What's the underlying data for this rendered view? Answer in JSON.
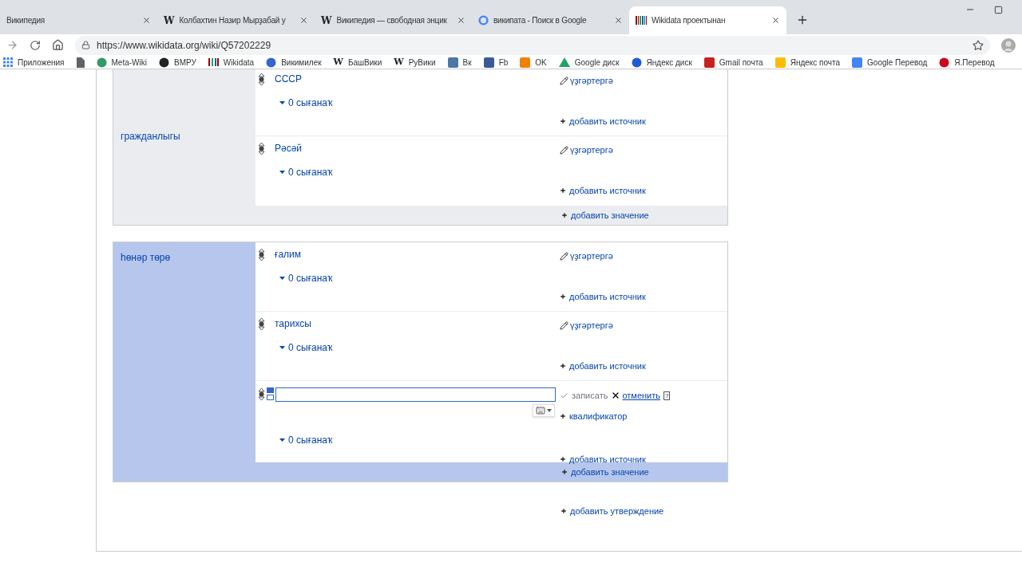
{
  "tabs": [
    {
      "title": "Википедия",
      "kind": "blank",
      "selected": false
    },
    {
      "title": "Колбахтин Назир Мырҙабай у",
      "kind": "letter",
      "badge": "W",
      "selected": false
    },
    {
      "title": "Википедия — свободная энцик",
      "kind": "letter",
      "badge": "W",
      "selected": false
    },
    {
      "title": "википата - Поиск в Google",
      "kind": "ring",
      "selected": false
    },
    {
      "title": "Wikidata проектынан",
      "kind": "bars",
      "selected": true
    }
  ],
  "address": "https://www.wikidata.org/wiki/Q57202229",
  "bookmarks": [
    {
      "label": "Приложения",
      "color": "#4285f4",
      "kind": "apps"
    },
    {
      "color": "#5f6368",
      "kind": "page"
    },
    {
      "label": "Meta-Wiki",
      "color": "#339966",
      "kind": "circle"
    },
    {
      "label": "ВМРУ",
      "color": "#222222",
      "kind": "circle"
    },
    {
      "label": "Wikidata",
      "color": "#990000",
      "kind": "bars"
    },
    {
      "label": "Викимилек",
      "color": "#3366cc",
      "kind": "circle"
    },
    {
      "label": "БашВики",
      "color": "#222222",
      "kind": "letter",
      "badge": "W"
    },
    {
      "label": "РуВики",
      "color": "#222222",
      "kind": "letter",
      "badge": "W"
    },
    {
      "label": "Вк",
      "color": "#4a76a8",
      "kind": "square"
    },
    {
      "label": "Fb",
      "color": "#3b5998",
      "kind": "square"
    },
    {
      "label": "OK",
      "color": "#ee8208",
      "kind": "square"
    },
    {
      "label": "Google диск",
      "color": "#1fa463",
      "kind": "triangle"
    },
    {
      "label": "Яндекс диск",
      "color": "#1e5bd6",
      "kind": "circle"
    },
    {
      "label": "Gmail почта",
      "color": "#c5221f",
      "kind": "square"
    },
    {
      "label": "Яндекс почта",
      "color": "#fbbc05",
      "kind": "square"
    },
    {
      "label": "Google Перевод",
      "color": "#4285f4",
      "kind": "square"
    },
    {
      "label": "Я.Перевод",
      "color": "#d0021b",
      "kind": "circle"
    }
  ],
  "statements": [
    {
      "property": "гражданлыгы",
      "selected": false,
      "values": [
        {
          "value": "СССР",
          "edit": "үҙгәртергә",
          "references": "0 сығанаҡ",
          "add_reference": "добавить источник",
          "editing": false
        },
        {
          "value": "Рәсәй",
          "edit": "үҙгәртергә",
          "references": "0 сығанаҡ",
          "add_reference": "добавить источник",
          "editing": false
        }
      ],
      "add_value": "добавить значение"
    },
    {
      "property": "һөнәр төрө",
      "selected": true,
      "values": [
        {
          "value": "ғалим",
          "edit": "үҙгәртергә",
          "references": "0 сығанаҡ",
          "add_reference": "добавить источник",
          "editing": false
        },
        {
          "value": "тарихсы",
          "edit": "үҙгәртергә",
          "references": "0 сығанаҡ",
          "add_reference": "добавить источник",
          "editing": false
        },
        {
          "editing": true,
          "save": "записать",
          "cancel": "отменить",
          "help": "?",
          "qualifier": "квалификатор",
          "references": "0 сығанаҡ",
          "add_reference": "добавить источник"
        }
      ],
      "add_value": "добавить значение"
    }
  ],
  "add_statement": "добавить утверждение"
}
